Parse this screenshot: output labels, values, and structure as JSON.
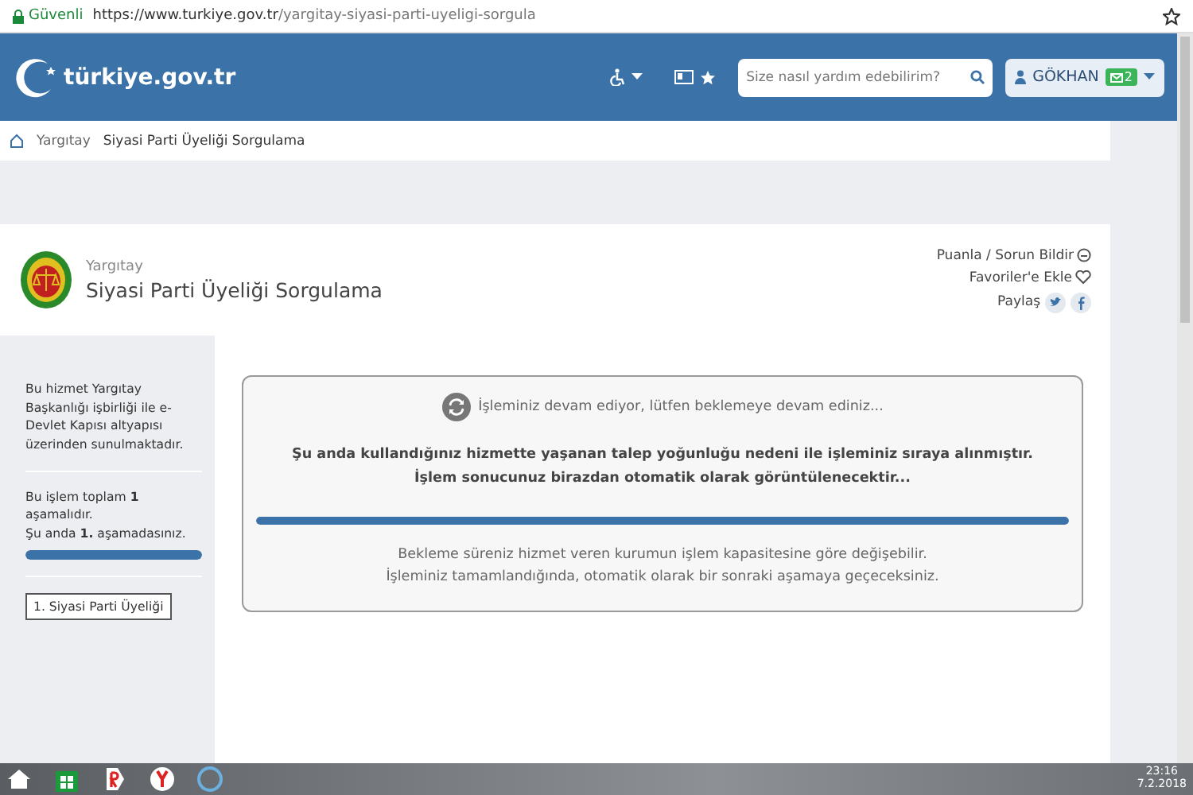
{
  "browser": {
    "secure_label": "Güvenli",
    "url_host": "https://www.turkiye.gov.tr",
    "url_path": "/yargitay-siyasi-parti-uyeligi-sorgula"
  },
  "header": {
    "logo": "türkiye.gov.tr",
    "search": {
      "placeholder": "Size nasıl yardım edebilirim?"
    },
    "user": "GÖKHAN",
    "message_count": "2"
  },
  "breadcrumb": [
    "Yargıtay",
    "Siyasi Parti Üyeliği Sorgulama"
  ],
  "service": {
    "agency": "Yargıtay",
    "title": "Siyasi Parti Üyeliği Sorgulama",
    "links": [
      "Puanla / Sorun Bildir",
      "Favoriler'e Ekle"
    ],
    "share_label": "Paylaş"
  },
  "sidebar": {
    "info": "Bu hizmet Yargıtay Başkanlığı işbirliği ile e-Devlet Kapısı altyapısı üzerinden sunulmaktadır.",
    "steps_text": "Bu işlem toplam **1** aşamalıdır.",
    "current_text": "Şu anda **1.** aşamadasınız.",
    "level": 1,
    "steps": [
      {
        "label": "1. Siyasi Parti Üyeliği",
        "selected": true
      }
    ]
  },
  "notice": {
    "status": "İşleminiz devam ediyor, lütfen beklemeye devam ediniz...",
    "message": "Şu anda kullandığınız hizmette yaşanan talep yoğunluğu nedeni ile işleminiz sıraya alınmıştır. İşlem sonucunuz birazdan otomatik olarak görüntülenecektir...",
    "level": 1,
    "footer_lines": [
      "Bekleme süreniz hizmet veren kurumun işlem kapasitesine göre değişebilir.",
      "İşleminiz tamamlandığında, otomatik olarak bir sonraki aşamaya geçeceksiniz."
    ]
  },
  "taskbar": {
    "time": "23:16",
    "date": "7.2.2018"
  }
}
